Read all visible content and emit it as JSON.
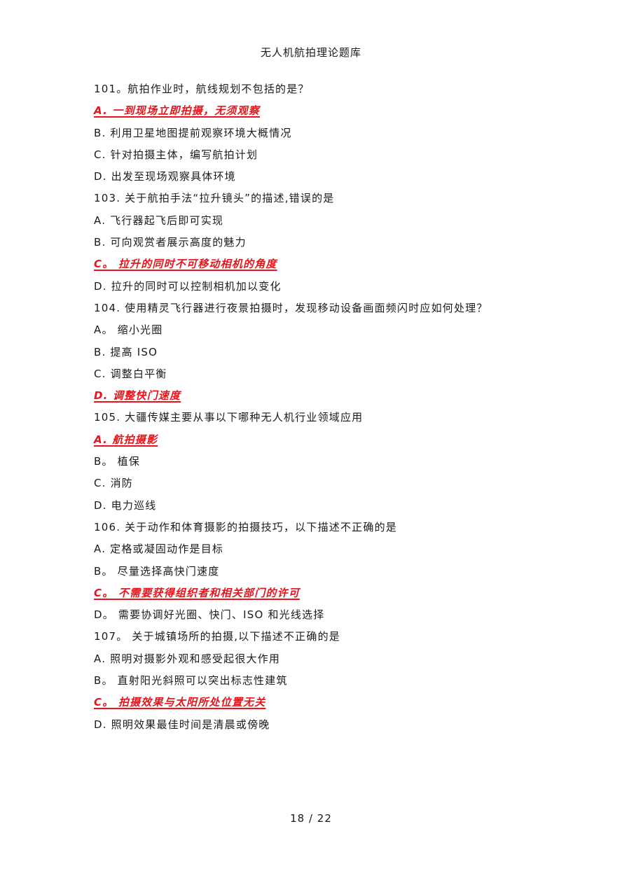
{
  "header": {
    "title": "无人机航拍理论题库"
  },
  "lines": [
    {
      "text": "101。航拍作业时，航线规划不包括的是？",
      "answer": false
    },
    {
      "text": "A.  一到现场立即拍摄，无须观察",
      "answer": true
    },
    {
      "text": "B.  利用卫星地图提前观察环境大概情况",
      "answer": false
    },
    {
      "text": "C.  针对拍摄主体，编写航拍计划",
      "answer": false
    },
    {
      "text": "D.  出发至现场观察具体环境",
      "answer": false
    },
    {
      "text": "103.  关于航拍手法“拉升镜头”的描述,错误的是",
      "answer": false
    },
    {
      "text": "A.  飞行器起飞后即可实现",
      "answer": false
    },
    {
      "text": "B.  可向观赏者展示高度的魅力",
      "answer": false
    },
    {
      "text": "C。 拉升的同时不可移动相机的角度",
      "answer": true
    },
    {
      "text": "D.  拉升的同时可以控制相机加以变化",
      "answer": false
    },
    {
      "text": "104.  使用精灵飞行器进行夜景拍摄时，发现移动设备画面频闪时应如何处理？",
      "answer": false
    },
    {
      "text": "A。 缩小光圈",
      "answer": false
    },
    {
      "text": "B.  提高 ISO",
      "answer": false
    },
    {
      "text": "C.  调整白平衡",
      "answer": false
    },
    {
      "text": "D.  调整快门速度",
      "answer": true
    },
    {
      "text": "105.  大疆传媒主要从事以下哪种无人机行业领域应用",
      "answer": false
    },
    {
      "text": "A.  航拍摄影",
      "answer": true
    },
    {
      "text": "B。 植保",
      "answer": false
    },
    {
      "text": "C.  消防",
      "answer": false
    },
    {
      "text": "D.  电力巡线",
      "answer": false
    },
    {
      "text": "106.  关于动作和体育摄影的拍摄技巧，以下描述不正确的是",
      "answer": false
    },
    {
      "text": "A.  定格或凝固动作是目标",
      "answer": false
    },
    {
      "text": "B。 尽量选择高快门速度",
      "answer": false
    },
    {
      "text": "C。 不需要获得组织者和相关部门的许可",
      "answer": true
    },
    {
      "text": "D。 需要协调好光圈、快门、ISO 和光线选择",
      "answer": false
    },
    {
      "text": "107。 关于城镇场所的拍摄,以下描述不正确的是",
      "answer": false
    },
    {
      "text": "A.  照明对摄影外观和感受起很大作用",
      "answer": false
    },
    {
      "text": "B。 直射阳光斜照可以突出标志性建筑",
      "answer": false
    },
    {
      "text": "C。 拍摄效果与太阳所处位置无关",
      "answer": true
    },
    {
      "text": "D.  照明效果最佳时间是清晨或傍晚",
      "answer": false
    }
  ],
  "footer": {
    "page_indicator": "18 / 22"
  },
  "colors": {
    "answer": "#e8141b",
    "text": "#1a1a1a"
  }
}
